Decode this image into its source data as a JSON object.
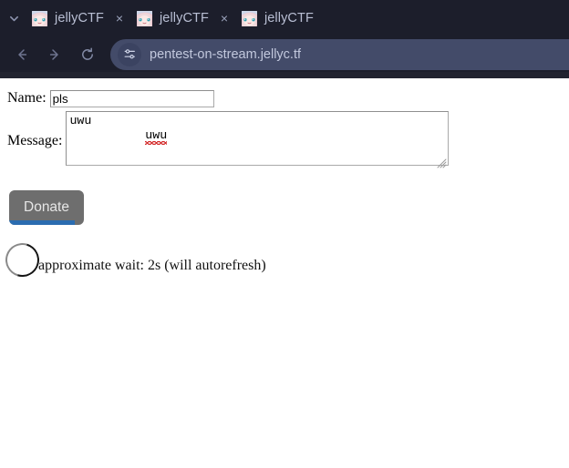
{
  "browser": {
    "tab_list_icon": "chevron-down-icon",
    "tabs": [
      {
        "title": "jellyCTF",
        "favicon": "jellyctf-anime-face-favicon",
        "close_label": "×"
      },
      {
        "title": "jellyCTF",
        "favicon": "jellyctf-anime-face-favicon",
        "close_label": "×"
      },
      {
        "title": "jellyCTF",
        "favicon": "jellyctf-anime-face-favicon",
        "close_label": "×"
      }
    ],
    "nav": {
      "back_icon": "back-arrow-icon",
      "forward_icon": "forward-arrow-icon",
      "reload_icon": "reload-icon"
    },
    "address_bar": {
      "site_info_icon": "site-settings-sliders-icon",
      "url": "pentest-on-stream.jellyc.tf"
    },
    "colors": {
      "chrome_background": "#1c1e2b",
      "url_bar_background": "#434b69",
      "tab_text": "#b9bfd4",
      "url_text": "#c2c8dd"
    }
  },
  "page": {
    "form": {
      "name_label": "Name:",
      "name_value": "pls",
      "name_placeholder": "",
      "message_label": "Message:",
      "message_value": "uwu",
      "message_placeholder": "",
      "message_misspelled_word": "uwu",
      "submit_label": "Donate",
      "submit_progress_percent": 88
    },
    "status": {
      "spinner_icon": "loading-spinner-icon",
      "text": "approximate wait: 2s (will autorefresh)"
    },
    "colors": {
      "background": "#ffffff",
      "button_background": "#6e6e6e",
      "button_text": "#e6e6e6",
      "progress_bar": "#2b6cb0",
      "spellcheck_underline": "#d01b1b"
    }
  }
}
